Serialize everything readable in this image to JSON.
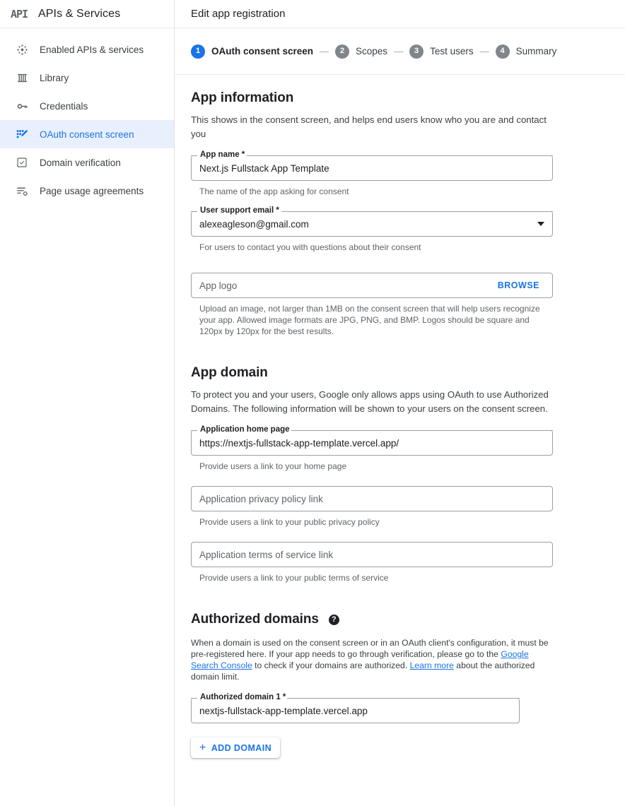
{
  "sidebar": {
    "logo_text": "API",
    "title": "APIs & Services",
    "items": [
      {
        "label": "Enabled APIs & services",
        "icon": "enabled-apis-icon",
        "active": false
      },
      {
        "label": "Library",
        "icon": "library-icon",
        "active": false
      },
      {
        "label": "Credentials",
        "icon": "key-icon",
        "active": false
      },
      {
        "label": "OAuth consent screen",
        "icon": "oauth-consent-icon",
        "active": true
      },
      {
        "label": "Domain verification",
        "icon": "domain-verification-icon",
        "active": false
      },
      {
        "label": "Page usage agreements",
        "icon": "page-usage-icon",
        "active": false
      }
    ],
    "active_color": "#1a73e8",
    "active_background": "#e8f0fe"
  },
  "header": {
    "title": "Edit app registration"
  },
  "stepper": {
    "steps": [
      {
        "number": "1",
        "label": "OAuth consent screen",
        "state": "current"
      },
      {
        "number": "2",
        "label": "Scopes",
        "state": "upcoming"
      },
      {
        "number": "3",
        "label": "Test users",
        "state": "upcoming"
      },
      {
        "number": "4",
        "label": "Summary",
        "state": "upcoming"
      }
    ],
    "separator": "—",
    "current_color": "#1a73e8",
    "inactive_color": "#80868b"
  },
  "app_information": {
    "title": "App information",
    "description": "This shows in the consent screen, and helps end users know who you are and contact you",
    "app_name": {
      "label": "App name *",
      "value": "Next.js Fullstack App Template",
      "helper": "The name of the app asking for consent"
    },
    "user_support_email": {
      "label": "User support email *",
      "value": "alexeagleson@gmail.com",
      "helper": "For users to contact you with questions about their consent"
    },
    "app_logo": {
      "placeholder": "App logo",
      "value": "",
      "browse_label": "BROWSE",
      "helper": "Upload an image, not larger than 1MB on the consent screen that will help users recognize your app. Allowed image formats are JPG, PNG, and BMP. Logos should be square and 120px by 120px for the best results."
    }
  },
  "app_domain": {
    "title": "App domain",
    "description": "To protect you and your users, Google only allows apps using OAuth to use Authorized Domains. The following information will be shown to your users on the consent screen.",
    "home_page": {
      "label": "Application home page",
      "value": "https://nextjs-fullstack-app-template.vercel.app/",
      "helper": "Provide users a link to your home page"
    },
    "privacy_policy": {
      "placeholder": "Application privacy policy link",
      "value": "",
      "helper": "Provide users a link to your public privacy policy"
    },
    "terms_of_service": {
      "placeholder": "Application terms of service link",
      "value": "",
      "helper": "Provide users a link to your public terms of service"
    }
  },
  "authorized_domains": {
    "title": "Authorized domains",
    "help_icon": "?",
    "paragraph_part1": "When a domain is used on the consent screen or in an OAuth client's configuration, it must be pre-registered here. If your app needs to go through verification, please go to the ",
    "link_google_search_console": "Google Search Console",
    "paragraph_part2": " to check if your domains are authorized. ",
    "link_learn_more": "Learn more",
    "paragraph_part3": " about the authorized domain limit.",
    "domain_1": {
      "label": "Authorized domain 1 *",
      "value": "nextjs-fullstack-app-template.vercel.app"
    },
    "add_domain_label": "ADD DOMAIN",
    "add_domain_plus": "+"
  }
}
